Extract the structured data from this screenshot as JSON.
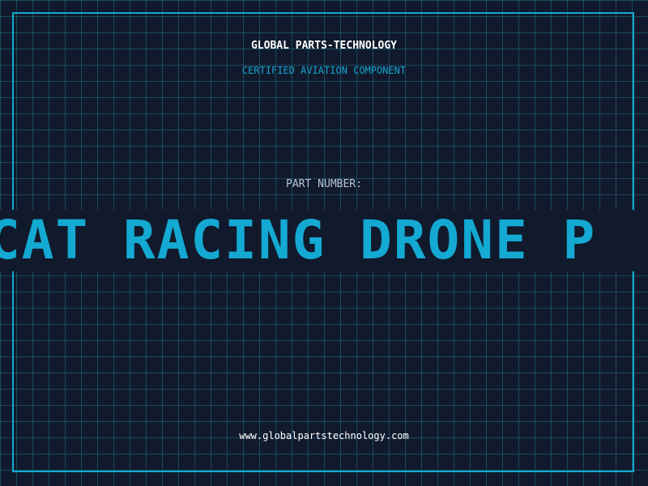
{
  "header": {
    "company": "GLOBAL PARTS-TECHNOLOGY",
    "subtitle": "CERTIFIED AVIATION COMPONENT"
  },
  "part": {
    "label": "PART NUMBER:",
    "number_visible": "CAT RACING DRONE P"
  },
  "footer": {
    "website": "www.globalpartstechnology.com"
  },
  "colors": {
    "background": "#111a2c",
    "accent": "#13a9d2",
    "grid": "#1f6e8c",
    "text_primary": "#ffffff",
    "text_muted": "#b9c5d3"
  }
}
